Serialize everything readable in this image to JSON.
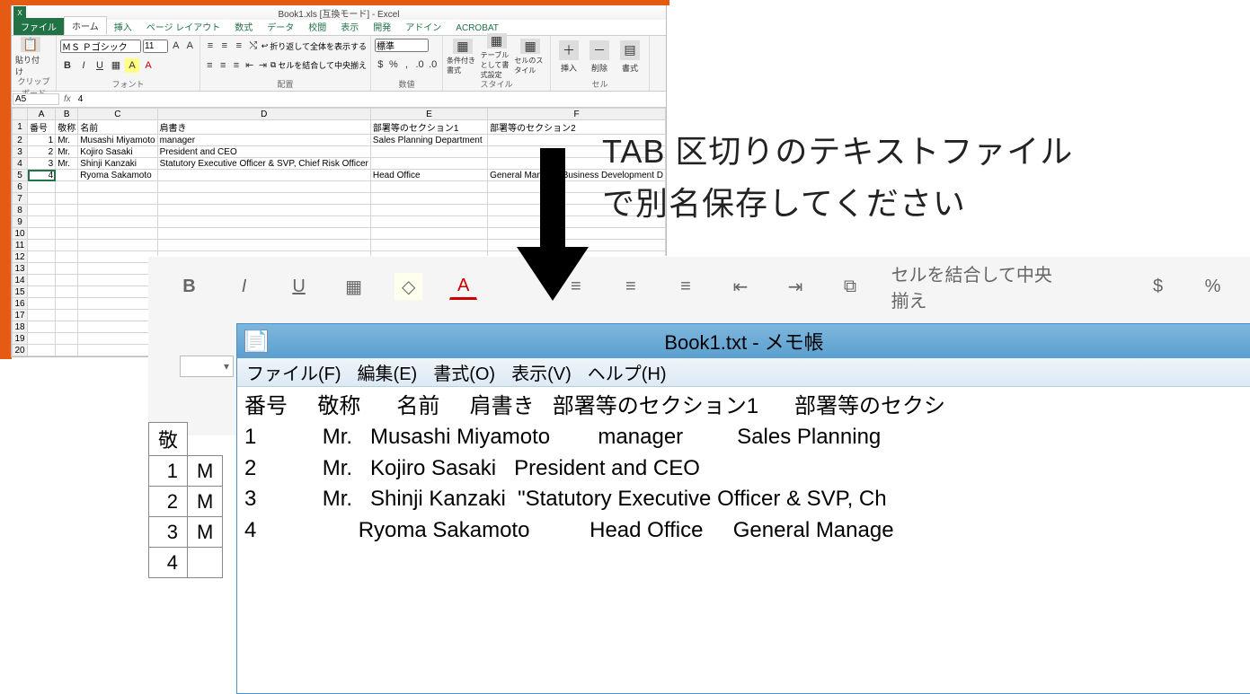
{
  "excel": {
    "title": "Book1.xls [互換モード] - Excel",
    "tabs": {
      "file": "ファイル",
      "home": "ホーム",
      "insert": "挿入",
      "layout": "ページ レイアウト",
      "formulas": "数式",
      "data": "データ",
      "review": "校閲",
      "view": "表示",
      "dev": "開発",
      "addin": "アドイン",
      "acrobat": "ACROBAT"
    },
    "ribbon": {
      "clipboard": {
        "label": "クリップボード",
        "paste": "貼り付け"
      },
      "font": {
        "label": "フォント",
        "name": "ＭＳ Ｐゴシック",
        "size": "11"
      },
      "align": {
        "label": "配置",
        "wrap": "折り返して全体を表示する",
        "merge": "セルを結合して中央揃え"
      },
      "number": {
        "label": "数値",
        "format": "標準"
      },
      "styles": {
        "label": "スタイル",
        "cond": "条件付き書式",
        "table": "テーブルとして書式設定",
        "cell": "セルのスタイル"
      },
      "cells": {
        "label": "セル",
        "insert": "挿入",
        "delete": "削除",
        "format": "書式"
      }
    },
    "namebox": "A5",
    "formula": "4",
    "columns": [
      "A",
      "B",
      "C",
      "D",
      "E",
      "F"
    ],
    "headers": {
      "A": "番号",
      "B": "敬称",
      "C": "名前",
      "D": "肩書き",
      "E": "部署等のセクション1",
      "F": "部署等のセクション2"
    },
    "rows": [
      {
        "A": "1",
        "B": "Mr.",
        "C": "Musashi Miyamoto",
        "D": "manager",
        "E": "Sales Planning Department",
        "F": ""
      },
      {
        "A": "2",
        "B": "Mr.",
        "C": "Kojiro Sasaki",
        "D": "President and CEO",
        "E": "",
        "F": ""
      },
      {
        "A": "3",
        "B": "Mr.",
        "C": "Shinji Kanzaki",
        "D": "Statutory Executive Officer & SVP, Chief Risk Officer",
        "E": "",
        "F": ""
      },
      {
        "A": "4",
        "B": "",
        "C": "Ryoma Sakamoto",
        "D": "",
        "E": "Head Office",
        "F": "General Manager Business Development D"
      }
    ]
  },
  "instruction": {
    "line1": "TAB 区切りのテキストファイル",
    "line2": "で別名保存してください"
  },
  "zoom": {
    "font": "フォント",
    "align": "配置",
    "merge": "セルを結合して中央揃え",
    "number": "数値",
    "hdrB": "敬"
  },
  "notepad": {
    "title": "Book1.txt - メモ帳",
    "menu": {
      "file": "ファイル(F)",
      "edit": "編集(E)",
      "format": "書式(O)",
      "view": "表示(V)",
      "help": "ヘルプ(H)"
    },
    "lines": [
      "番号     敬称      名前     肩書き   部署等のセクション1      部署等のセクシ",
      "1           Mr.   Musashi Miyamoto        manager         Sales Planning",
      "2           Mr.   Kojiro Sasaki   President and CEO",
      "3           Mr.   Shinji Kanzaki  \"Statutory Executive Officer & SVP, Ch",
      "4                 Ryoma Sakamoto          Head Office     General Manage"
    ]
  }
}
